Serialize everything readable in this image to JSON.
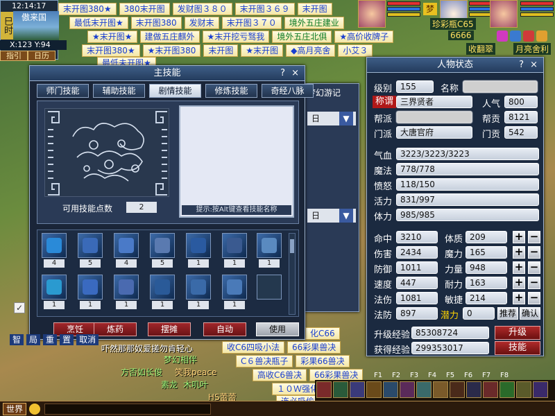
{
  "top_left": {
    "time": "12:14:17",
    "period": "巳时",
    "map_name": "傲来国",
    "coords": "X:123 Y:94",
    "btn_guide": "指引",
    "btn_calendar": "日历"
  },
  "banners": {
    "row1": [
      "末开图380★",
      "380末开图",
      "发财图３８０",
      "末开图３６９",
      "末开图"
    ],
    "row2": [
      "最低末开图★",
      "末开图380",
      "发财末",
      "末开图３７０",
      "境外五庄建业"
    ],
    "row3": [
      "★末开图★",
      "建做五庄麒外",
      "★末开挖亏驽我",
      "境外五庄北俱",
      "★高价收牌子"
    ],
    "row4": [
      "末开图380★",
      "★末开图380",
      "末开图",
      "★末开图",
      "◆高月亮舍",
      "小艾３"
    ],
    "row5": [
      "最低未开图★",
      "化C66"
    ],
    "row6": [
      "收C6四吸小法",
      "66彩果兽决"
    ],
    "row7": [
      "C６兽决瓶子",
      "彩果66兽决"
    ],
    "row8": [
      "高收C6兽决",
      "66彩果兽决"
    ],
    "row9": [
      "１０Ｗ强化"
    ],
    "row10": [
      "连必吸偷秀"
    ]
  },
  "top_right": {
    "gold_badge": "梦",
    "tag1": "6666",
    "tag2": "收翻翠",
    "tag3": "月亮舍利",
    "tag4": "珍彩瓶C65"
  },
  "skill_window": {
    "title": "主技能",
    "help": "?",
    "close": "×",
    "tabs": [
      {
        "label": "师门技能",
        "active": false
      },
      {
        "label": "辅助技能",
        "active": false
      },
      {
        "label": "剧情技能",
        "active": true
      },
      {
        "label": "修炼技能",
        "active": false
      },
      {
        "label": "奇经八脉",
        "active": false
      }
    ],
    "hint": "提示:按Alt键查看技能名称",
    "points_label": "可用技能点数",
    "points_value": "2",
    "row1_counts": [
      "4",
      "5",
      "4",
      "5",
      "1",
      "1",
      "1"
    ],
    "row2_counts": [
      "1",
      "1",
      "1",
      "1",
      "1",
      "1"
    ],
    "buttons": [
      "烹饪",
      "炼药",
      "摆摊",
      "自动",
      "使用"
    ]
  },
  "ghost_window": {
    "title": "梦幻游记",
    "day1": "日",
    "day2": "日"
  },
  "char_window": {
    "title": "人物状态",
    "help": "?",
    "close": "×",
    "level_label": "级别",
    "level": "155",
    "name_label": "名称",
    "title_tag": "称谓",
    "title_value": "三界贤者",
    "pop_label": "人气",
    "pop": "800",
    "gang_label": "帮派",
    "gangcont_label": "帮贡",
    "gangcont": "8121",
    "school_label": "门派",
    "school": "大唐官府",
    "schoolcont_label": "门贡",
    "schoolcont": "542",
    "hp_label": "气血",
    "hp": "3223/3223/3223",
    "mp_label": "魔法",
    "mp": "778/778",
    "anger_label": "愤怒",
    "anger": "118/150",
    "vitality_label": "活力",
    "vitality": "831/997",
    "stamina_label": "体力",
    "stamina": "985/985",
    "hit_label": "命中",
    "hit": "3210",
    "con_label": "体质",
    "con": "209",
    "dmg_label": "伤害",
    "dmg": "2434",
    "mag_label": "魔力",
    "mag": "165",
    "def_label": "防御",
    "def": "1011",
    "str_label": "力量",
    "str": "948",
    "spd_label": "速度",
    "spd": "447",
    "end_label": "耐力",
    "end": "163",
    "mdmg_label": "法伤",
    "mdmg": "1081",
    "agi_label": "敏捷",
    "agi": "214",
    "mdef_label": "法防",
    "mdef": "897",
    "potential_label": "潜力",
    "potential": "0",
    "recommend": "推荐",
    "confirm": "确认",
    "upexp_label": "升级经验",
    "upexp": "85308724",
    "gotexp_label": "获得经验",
    "gotexp": "299353017",
    "levelup_btn": "升级",
    "skills_btn": "技能"
  },
  "chat": {
    "line1": "吓然那那奴爱搓勿肯轻心",
    "line2": "梦幻相伴",
    "line3": "方否如长俊",
    "line4": "笑我peace",
    "line5": "素龙",
    "line6": "木叽叶",
    "line7": "HS蕾蕾",
    "channel_btns": [
      "智",
      "局",
      "重",
      "置",
      "取消"
    ],
    "checkbox": "✓",
    "world": "世界"
  },
  "fkeys": [
    "F1",
    "F2",
    "F3",
    "F4",
    "F5",
    "F6",
    "F7",
    "F8"
  ]
}
